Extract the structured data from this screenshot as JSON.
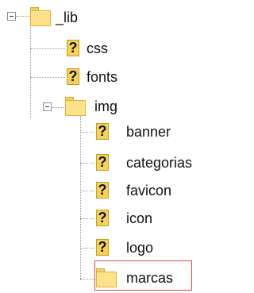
{
  "tree": {
    "root": {
      "label": "_lib",
      "icon": "folder-icon",
      "expanded": true
    },
    "children": [
      {
        "label": "css",
        "icon": "unknown-file-icon"
      },
      {
        "label": "fonts",
        "icon": "unknown-file-icon"
      },
      {
        "label": "img",
        "icon": "folder-icon",
        "expanded": true,
        "children": [
          {
            "label": "banner",
            "icon": "unknown-file-icon"
          },
          {
            "label": "categorias",
            "icon": "unknown-file-icon"
          },
          {
            "label": "favicon",
            "icon": "unknown-file-icon"
          },
          {
            "label": "icon",
            "icon": "unknown-file-icon"
          },
          {
            "label": "logo",
            "icon": "unknown-file-icon"
          },
          {
            "label": "marcas",
            "icon": "folder-icon",
            "selected": true
          }
        ]
      }
    ]
  },
  "colors": {
    "selection_border": "#e24a4a",
    "folder_fill": "#fde28a",
    "unknown_fill": "#f4d356"
  },
  "glyphs": {
    "unknown": "?"
  }
}
